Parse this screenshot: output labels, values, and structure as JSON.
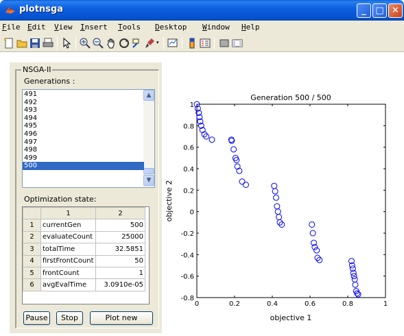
{
  "window": {
    "title": "plotnsga"
  },
  "menu": {
    "items": [
      {
        "label": "File",
        "key": "F",
        "rest": "ile"
      },
      {
        "label": "Edit",
        "key": "E",
        "rest": "dit"
      },
      {
        "label": "View",
        "key": "V",
        "rest": "iew"
      },
      {
        "label": "Insert",
        "key": "I",
        "rest": "nsert"
      },
      {
        "label": "Tools",
        "key": "T",
        "rest": "ools"
      },
      {
        "label": "Desktop",
        "key": "D",
        "rest": "esktop"
      },
      {
        "label": "Window",
        "key": "W",
        "rest": "indow"
      },
      {
        "label": "Help",
        "key": "H",
        "rest": "elp"
      }
    ]
  },
  "toolbar": {
    "icons": [
      "new-figure-icon",
      "open-file-icon",
      "save-icon",
      "print-icon",
      "pointer-icon",
      "zoom-in-icon",
      "zoom-out-icon",
      "pan-icon",
      "rotate-icon",
      "data-cursor-icon",
      "brush-icon",
      "link-plot-icon",
      "colorbar-icon",
      "legend-icon",
      "hide-plot-tools-icon",
      "show-plot-tools-icon"
    ]
  },
  "panel": {
    "title": "NSGA-II",
    "generations_label": "Generations :",
    "generations": [
      "491",
      "492",
      "493",
      "494",
      "495",
      "496",
      "497",
      "498",
      "499",
      "500"
    ],
    "selected_generation": "500",
    "state_label": "Optimization state:",
    "table": {
      "columns": [
        "1",
        "2"
      ],
      "rows": [
        {
          "index": "1",
          "name": "currentGen",
          "value": "500"
        },
        {
          "index": "2",
          "name": "evaluateCount",
          "value": "25000"
        },
        {
          "index": "3",
          "name": "totalTime",
          "value": "32.5851"
        },
        {
          "index": "4",
          "name": "firstFrontCount",
          "value": "50"
        },
        {
          "index": "5",
          "name": "frontCount",
          "value": "1"
        },
        {
          "index": "6",
          "name": "avgEvalTime",
          "value": "3.0910e-05"
        }
      ]
    },
    "buttons": {
      "pause": "Pause",
      "stop": "Stop",
      "plot_new": "Plot new"
    }
  },
  "chart_data": {
    "type": "scatter",
    "title": "Generation 500 / 500",
    "xlabel": "objective 1",
    "ylabel": "objective 2",
    "xlim": [
      0,
      1
    ],
    "ylim": [
      -0.8,
      1
    ],
    "xticks": [
      "0",
      "0.2",
      "0.4",
      "0.6",
      "0.8",
      "1"
    ],
    "yticks": [
      "1",
      "0.8",
      "0.6",
      "0.4",
      "0.2",
      "0",
      "-0.2",
      "-0.4",
      "-0.6",
      "-0.8"
    ],
    "marker_color": "#0000ff",
    "grid": false,
    "series": [
      {
        "x": [
          0.0,
          0.005,
          0.01,
          0.014,
          0.018,
          0.023,
          0.03,
          0.04,
          0.05,
          0.08,
          0.183,
          0.185,
          0.195,
          0.205,
          0.21,
          0.215,
          0.225,
          0.24,
          0.26,
          0.41,
          0.415,
          0.42,
          0.425,
          0.43,
          0.435,
          0.44,
          0.45,
          0.61,
          0.615,
          0.62,
          0.625,
          0.635,
          0.64,
          0.65,
          0.82,
          0.823,
          0.827,
          0.83,
          0.833,
          0.837,
          0.84,
          0.845,
          0.85,
          0.855
        ],
        "y": [
          1.0,
          0.96,
          0.92,
          0.88,
          0.84,
          0.8,
          0.76,
          0.72,
          0.7,
          0.67,
          0.67,
          0.66,
          0.58,
          0.5,
          0.48,
          0.42,
          0.38,
          0.28,
          0.25,
          0.24,
          0.19,
          0.13,
          0.05,
          0.0,
          -0.05,
          -0.1,
          -0.12,
          -0.12,
          -0.2,
          -0.29,
          -0.33,
          -0.36,
          -0.43,
          -0.45,
          -0.46,
          -0.5,
          -0.53,
          -0.57,
          -0.6,
          -0.63,
          -0.68,
          -0.74,
          -0.76,
          -0.77
        ]
      }
    ]
  }
}
